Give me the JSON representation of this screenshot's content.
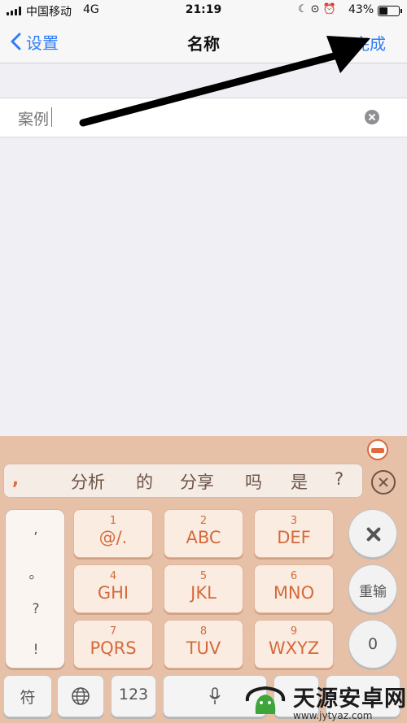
{
  "status_bar": {
    "carrier": "中国移动",
    "network": "4G",
    "time": "21:19",
    "icons": [
      "moon-icon",
      "orientation-lock-icon",
      "alarm-icon"
    ],
    "battery_percent": "43%",
    "battery_level": 0.43
  },
  "nav": {
    "back_label": "设置",
    "title": "名称",
    "done_label": "完成"
  },
  "name_field": {
    "value": "案例"
  },
  "annotation": {
    "arrow_color": "#000000"
  },
  "keyboard": {
    "candidates": [
      ",",
      "分析",
      "的",
      "分享",
      "吗",
      "是",
      "?"
    ],
    "punctuation": [
      ",",
      "。",
      "?",
      "!"
    ],
    "keys": [
      {
        "num": "1",
        "letters": "@/."
      },
      {
        "num": "2",
        "letters": "ABC"
      },
      {
        "num": "3",
        "letters": "DEF"
      },
      {
        "num": "4",
        "letters": "GHI"
      },
      {
        "num": "5",
        "letters": "JKL"
      },
      {
        "num": "6",
        "letters": "MNO"
      },
      {
        "num": "7",
        "letters": "PQRS"
      },
      {
        "num": "8",
        "letters": "TUV"
      },
      {
        "num": "9",
        "letters": "WXYZ"
      }
    ],
    "reenter_label": "重输",
    "zero_label": "0",
    "symbol_label": "符",
    "number_label": "123",
    "accent_color": "#d46a3c",
    "background_color": "#e6c1a8"
  },
  "watermark": {
    "title": "天源安卓网",
    "url": "www.jytyaz.com"
  }
}
